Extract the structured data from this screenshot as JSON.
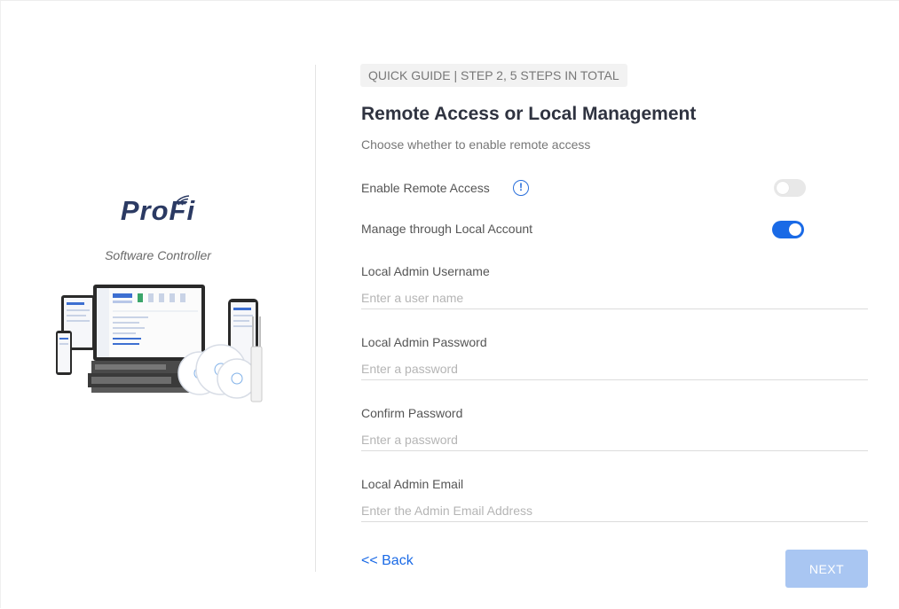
{
  "brand": {
    "logo_text": "ProFi",
    "subtitle": "Software Controller"
  },
  "guide": {
    "badge": "QUICK GUIDE | STEP 2, 5 STEPS IN TOTAL",
    "title": "Remote Access or Local Management",
    "subtitle": "Choose whether to enable remote access"
  },
  "settings": {
    "remote_access": {
      "label": "Enable Remote Access",
      "enabled": false
    },
    "local_account": {
      "label": "Manage through Local Account",
      "enabled": true
    }
  },
  "fields": {
    "username": {
      "label": "Local Admin Username",
      "placeholder": "Enter a user name",
      "value": ""
    },
    "password": {
      "label": "Local Admin Password",
      "placeholder": "Enter a password",
      "value": ""
    },
    "confirm": {
      "label": "Confirm Password",
      "placeholder": "Enter a password",
      "value": ""
    },
    "email": {
      "label": "Local Admin Email",
      "placeholder": "Enter the Admin Email Address",
      "value": ""
    }
  },
  "actions": {
    "back_label": "<< Back",
    "next_label": "NEXT"
  },
  "colors": {
    "accent": "#1a6ae6",
    "next_disabled": "#a9c6f2",
    "brand_navy": "#2b3a63"
  },
  "icons": {
    "info": "info-circle-icon",
    "wifi": "wifi-signal-icon"
  }
}
